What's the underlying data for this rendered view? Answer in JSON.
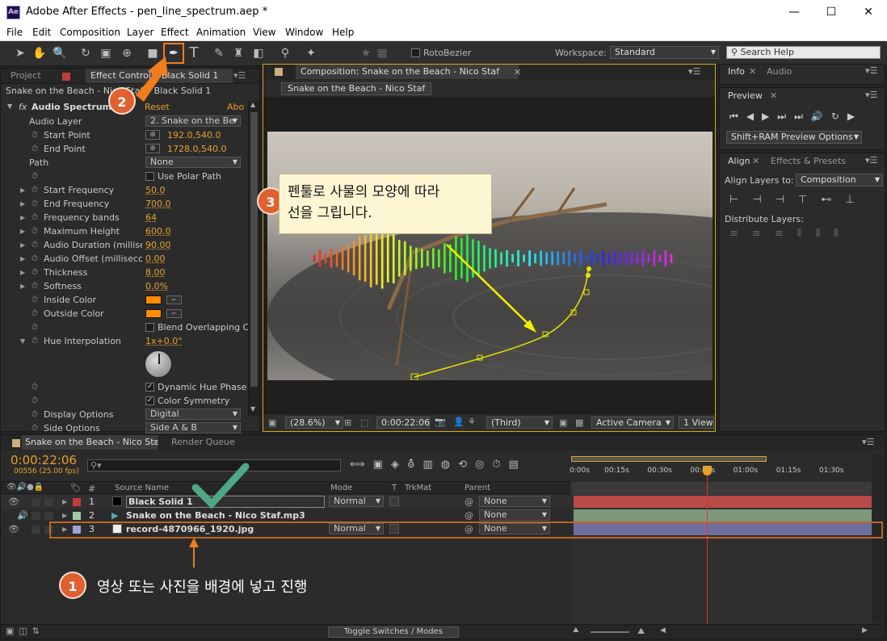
{
  "window": {
    "title": "Adobe After Effects - pen_line_spectrum.aep *",
    "app_icon": "Ae",
    "minimize": "—",
    "maximize": "☐",
    "close": "✕"
  },
  "menu": [
    "File",
    "Edit",
    "Composition",
    "Layer",
    "Effect",
    "Animation",
    "View",
    "Window",
    "Help"
  ],
  "toolbar": {
    "rotobezier": "RotoBezier",
    "workspace_label": "Workspace:",
    "workspace_value": "Standard",
    "search_placeholder": "Search Help"
  },
  "left_panel": {
    "tabs": [
      "Project",
      "Effect Controls: Black Solid 1"
    ],
    "breadcrumb": "Snake on the Beach - Nico Staf • Black Solid 1",
    "effect_name": "Audio Spectrum",
    "reset": "Reset",
    "about": "Abo",
    "rows": [
      {
        "label": "Audio Layer",
        "value": "2. Snake on the Be",
        "kind": "dropdown"
      },
      {
        "label": "Start Point",
        "value": "192.0,540.0",
        "kind": "point"
      },
      {
        "label": "End Point",
        "value": "1728.0,540.0",
        "kind": "point"
      },
      {
        "label": "Path",
        "value": "None",
        "kind": "dropdown"
      },
      {
        "label": "",
        "value": "Use Polar Path",
        "kind": "checkbox",
        "checked": false
      },
      {
        "label": "Start Frequency",
        "value": "50.0",
        "kind": "num"
      },
      {
        "label": "End Frequency",
        "value": "700.0",
        "kind": "num"
      },
      {
        "label": "Frequency bands",
        "value": "64",
        "kind": "num"
      },
      {
        "label": "Maximum Height",
        "value": "600.0",
        "kind": "num"
      },
      {
        "label": "Audio Duration (millisec",
        "value": "90.00",
        "kind": "num"
      },
      {
        "label": "Audio Offset (millisecon",
        "value": "0.00",
        "kind": "num"
      },
      {
        "label": "Thickness",
        "value": "8.00",
        "kind": "num"
      },
      {
        "label": "Softness",
        "value": "0.0%",
        "kind": "num"
      },
      {
        "label": "Inside Color",
        "value": "",
        "kind": "color"
      },
      {
        "label": "Outside Color",
        "value": "",
        "kind": "color"
      },
      {
        "label": "",
        "value": "Blend Overlapping C",
        "kind": "checkbox",
        "checked": false
      },
      {
        "label": "Hue Interpolation",
        "value": "1x+0.0°",
        "kind": "num"
      },
      {
        "label": "",
        "value": "Dynamic Hue Phase",
        "kind": "checkbox",
        "checked": true
      },
      {
        "label": "",
        "value": "Color Symmetry",
        "kind": "checkbox",
        "checked": true
      },
      {
        "label": "Display Options",
        "value": "Digital",
        "kind": "dropdown"
      },
      {
        "label": "Side Options",
        "value": "Side A & B",
        "kind": "dropdown"
      }
    ]
  },
  "comp_panel": {
    "tab": "Composition: Snake on the Beach - Nico Staf",
    "subtab": "Snake on the Beach - Nico Staf",
    "zoom": "(28.6%)",
    "timecode": "0:00:22:06",
    "resolution": "(Third)",
    "camera": "Active Camera",
    "views": "1 View"
  },
  "right_panels": {
    "info_tabs": [
      "Info",
      "Audio"
    ],
    "preview_tab": "Preview",
    "preview_options": "Shift+RAM Preview Options",
    "align_tabs": [
      "Align",
      "Effects & Presets"
    ],
    "align_layers_to": "Align Layers to:",
    "align_target": "Composition",
    "distribute": "Distribute Layers:"
  },
  "timeline": {
    "tabs": [
      "Snake on the Beach - Nico Staf",
      "Render Queue"
    ],
    "timecode": "0:00:22:06",
    "fps": "00556 (25.00 fps)",
    "columns": {
      "num": "#",
      "source": "Source Name",
      "mode": "Mode",
      "t": "T",
      "trkmat": "TrkMat",
      "parent": "Parent"
    },
    "ruler": [
      "0:00s",
      "00:15s",
      "00:30s",
      "00:45s",
      "01:00s",
      "01:15s",
      "01:30s"
    ],
    "layers": [
      {
        "num": "1",
        "name": "Black Solid 1",
        "mode": "Normal",
        "parent": "None",
        "color": "#c43c3c",
        "bar": "#b84a4a"
      },
      {
        "num": "2",
        "name": "Snake on the Beach - Nico Staf.mp3",
        "mode": "",
        "parent": "None",
        "color": "#a5c9a5",
        "bar": "#7e987e"
      },
      {
        "num": "3",
        "name": "record-4870966_1920.jpg",
        "mode": "Normal",
        "parent": "None",
        "color": "#a0a0d8",
        "bar": "#6f6f9e"
      }
    ],
    "toggle": "Toggle Switches / Modes",
    "playhead_fraction": 0.22
  },
  "annotations": {
    "step1": {
      "num": "1",
      "text": "영상 또는 사진을 배경에 넣고 진행"
    },
    "step2": {
      "num": "2"
    },
    "step3": {
      "num": "3",
      "line1": "펜툴로 사물의 모양에 따라",
      "line2": "선을 그립니다."
    },
    "accent": "#f07c1e"
  }
}
